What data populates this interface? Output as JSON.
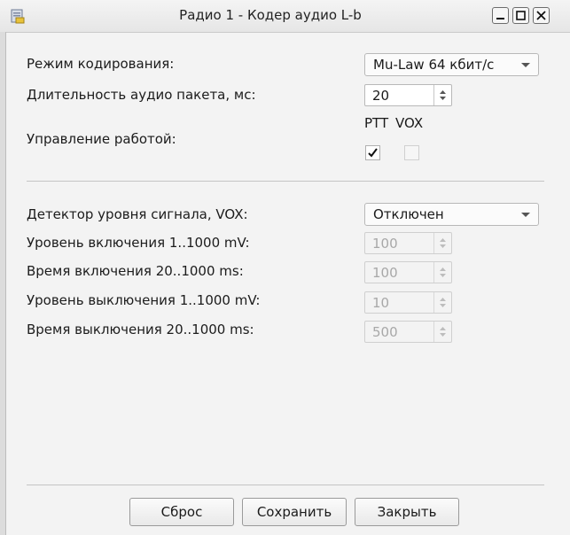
{
  "window": {
    "title": "Радио 1 - Кодер аудио L-b",
    "icon": "app-document-icon",
    "controls": [
      "minimize-icon",
      "maximize-icon",
      "close-icon"
    ]
  },
  "encoding": {
    "mode_label": "Режим кодирования:",
    "mode_value": "Mu-Law 64 кбит/с",
    "packet_label": "Длительность аудио пакета, мс:",
    "packet_value": "20",
    "control_label": "Управление работой:",
    "ptt_label": "PTT",
    "vox_label": "VOX",
    "ptt_checked": true,
    "vox_checked": false,
    "vox_enabled": false
  },
  "vox": {
    "detector_label": "Детектор уровня сигнала, VOX:",
    "detector_value": "Отключен",
    "on_level_label": "Уровень включения 1..1000 mV:",
    "on_level_value": "100",
    "on_time_label": "Время включения 20..1000 ms:",
    "on_time_value": "100",
    "off_level_label": "Уровень выключения 1..1000 mV:",
    "off_level_value": "10",
    "off_time_label": "Время выключения 20..1000 ms:",
    "off_time_value": "500",
    "fields_enabled": false
  },
  "buttons": {
    "reset": "Сброс",
    "save": "Сохранить",
    "close": "Закрыть"
  }
}
